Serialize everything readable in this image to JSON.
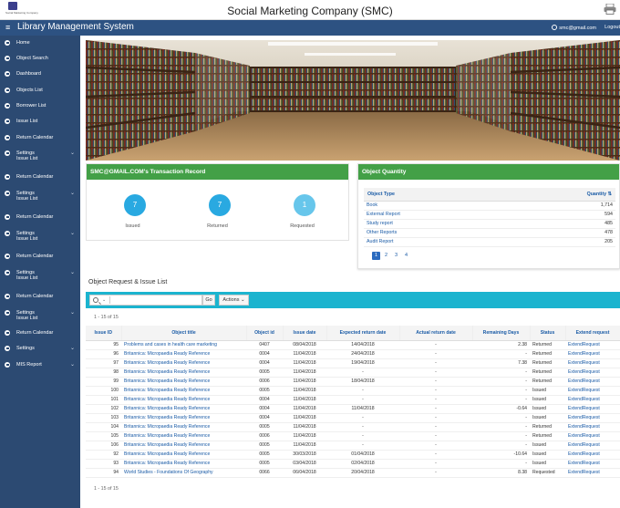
{
  "header": {
    "logo_caption": "Social Marketing Company",
    "company": "Social Marketing Company (SMC)",
    "app_title": "Library Management System",
    "user_email": "smc@gmail.com",
    "logout": "Logout"
  },
  "sidebar": {
    "items": [
      {
        "label": "Home"
      },
      {
        "label": "Object Search"
      },
      {
        "label": "Dashboard"
      },
      {
        "label": "Objects List"
      },
      {
        "label": "Borrower List"
      },
      {
        "label": "Issue List"
      },
      {
        "label": "Return Calendar"
      },
      {
        "label": "Settings",
        "sub": "Issue List"
      },
      {
        "label": "Return Calendar"
      },
      {
        "label": "Settings",
        "sub": "Issue List"
      },
      {
        "label": "Return Calendar"
      },
      {
        "label": "Settings",
        "sub": "Issue List"
      },
      {
        "label": "Return Calendar"
      },
      {
        "label": "Settings",
        "sub": "Issue List"
      },
      {
        "label": "Return Calendar"
      },
      {
        "label": "Settings",
        "sub": "Issue List"
      },
      {
        "label": "Return Calendar"
      },
      {
        "label": "Settings"
      },
      {
        "label": "MIS Report"
      }
    ]
  },
  "transactions": {
    "title": "SMC@GMAIL.COM's Transaction Record",
    "issued_value": "7",
    "issued_label": "Issued",
    "returned_value": "7",
    "returned_label": "Returned",
    "requested_value": "1",
    "requested_label": "Requested"
  },
  "quantity": {
    "title": "Object Quantity",
    "col_type": "Object Type",
    "col_qty": "Quantity",
    "rows": [
      {
        "type": "Book",
        "qty": "1,714"
      },
      {
        "type": "External Report",
        "qty": "594"
      },
      {
        "type": "Study report",
        "qty": "485"
      },
      {
        "type": "Other Reports",
        "qty": "478"
      },
      {
        "type": "Audit Report",
        "qty": "205"
      }
    ],
    "pages": [
      "1",
      "2",
      "3",
      "4"
    ]
  },
  "requests": {
    "title": "Object Request & Issue List",
    "go": "Go",
    "actions": "Actions",
    "range": "1 - 15 of 15",
    "columns": [
      "Issue ID",
      "Object title",
      "Object id",
      "Issue date",
      "Expected return date",
      "Actual return date",
      "Remaining Days",
      "Status",
      "Extend request"
    ],
    "rows": [
      [
        "95",
        "Problems and cases in health care marketing",
        "0407",
        "08/04/2018",
        "14/04/2018",
        "-",
        "2.38",
        "Returned",
        "ExtendRequest"
      ],
      [
        "96",
        "Britannica: Micropaedia Ready Reference",
        "0004",
        "11/04/2018",
        "24/04/2018",
        "-",
        "-",
        "Returned",
        "ExtendRequest"
      ],
      [
        "97",
        "Britannica: Micropaedia Ready Reference",
        "0004",
        "11/04/2018",
        "19/04/2018",
        "-",
        "7.38",
        "Returned",
        "ExtendRequest"
      ],
      [
        "98",
        "Britannica: Micropaedia Ready Reference",
        "0005",
        "11/04/2018",
        "-",
        "-",
        "-",
        "Returned",
        "ExtendRequest"
      ],
      [
        "99",
        "Britannica: Micropaedia Ready Reference",
        "0006",
        "11/04/2018",
        "18/04/2018",
        "-",
        "-",
        "Returned",
        "ExtendRequest"
      ],
      [
        "100",
        "Britannica: Micropaedia Ready Reference",
        "0005",
        "11/04/2018",
        "-",
        "-",
        "-",
        "Issued",
        "ExtendRequest"
      ],
      [
        "101",
        "Britannica: Micropaedia Ready Reference",
        "0004",
        "11/04/2018",
        "-",
        "-",
        "-",
        "Issued",
        "ExtendRequest"
      ],
      [
        "102",
        "Britannica: Micropaedia Ready Reference",
        "0004",
        "11/04/2018",
        "11/04/2018",
        "-",
        "-0.64",
        "Issued",
        "ExtendRequest"
      ],
      [
        "103",
        "Britannica: Micropaedia Ready Reference",
        "0004",
        "11/04/2018",
        "-",
        "-",
        "-",
        "Issued",
        "ExtendRequest"
      ],
      [
        "104",
        "Britannica: Micropaedia Ready Reference",
        "0005",
        "11/04/2018",
        "-",
        "-",
        "-",
        "Returned",
        "ExtendRequest"
      ],
      [
        "105",
        "Britannica: Micropaedia Ready Reference",
        "0006",
        "11/04/2018",
        "-",
        "-",
        "-",
        "Returned",
        "ExtendRequest"
      ],
      [
        "106",
        "Britannica: Micropaedia Ready Reference",
        "0005",
        "11/04/2018",
        "-",
        "-",
        "-",
        "Issued",
        "ExtendRequest"
      ],
      [
        "92",
        "Britannica: Micropaedia Ready Reference",
        "0005",
        "30/03/2018",
        "01/04/2018",
        "-",
        "-10.64",
        "Issued",
        "ExtendRequest"
      ],
      [
        "93",
        "Britannica: Micropaedia Ready Reference",
        "0005",
        "03/04/2018",
        "02/04/2018",
        "-",
        "-",
        "Issued",
        "ExtendRequest"
      ],
      [
        "94",
        "World Studies - Foundations Of Geography",
        "0066",
        "06/04/2018",
        "20/04/2018",
        "-",
        "8.38",
        "Requested",
        "ExtendRequest"
      ]
    ]
  },
  "colors": {
    "header_bg": "#2d5282",
    "sidebar_bg": "#2c4a72",
    "card_header_green": "#43a047",
    "toolbar_cyan": "#1bb4cf",
    "stat_blue": "#29a9e1",
    "link_blue": "#1a5ba6"
  },
  "icons": [
    "hamburger-icon",
    "user-icon",
    "printer-icon",
    "search-icon",
    "sort-icon",
    "chevron-down-icon"
  ]
}
